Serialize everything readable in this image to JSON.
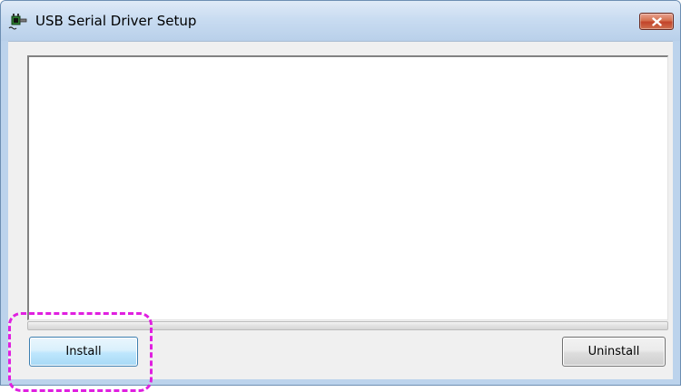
{
  "window": {
    "title": "USB Serial Driver Setup",
    "icon": "usb-serial-app-icon",
    "close_icon": "close-icon"
  },
  "log_panel": {
    "content": ""
  },
  "progress": {
    "value": 0
  },
  "buttons": {
    "install_label": "Install",
    "uninstall_label": "Uninstall"
  },
  "annotation": {
    "highlight_color": "#e020e0",
    "highlight_target": "install-button"
  },
  "colors": {
    "title_bar": "#c9dcf1",
    "close_button": "#c2442a",
    "client_bg": "#f0f0f0",
    "install_button": "#bee6fd",
    "uninstall_button": "#dddddd"
  }
}
